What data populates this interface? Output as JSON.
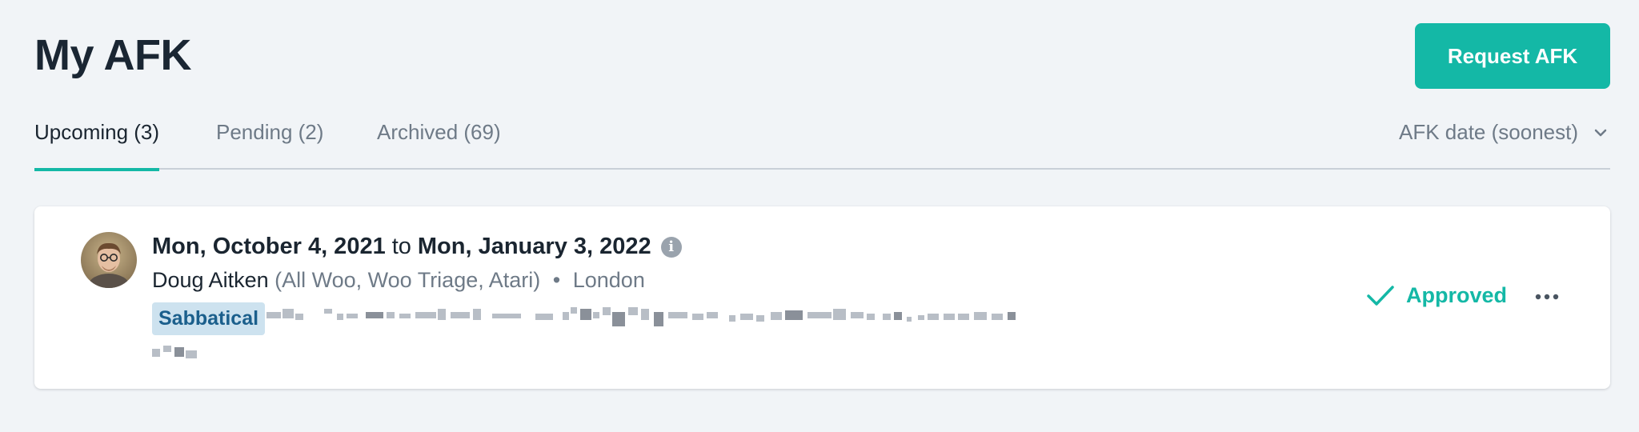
{
  "header": {
    "title": "My AFK",
    "request_button": "Request AFK"
  },
  "tabs": [
    {
      "label": "Upcoming (3)",
      "active": true
    },
    {
      "label": "Pending (2)",
      "active": false
    },
    {
      "label": "Archived (69)",
      "active": false
    }
  ],
  "sort": {
    "selected": "AFK date (soonest)"
  },
  "afk_item": {
    "start_date": "Mon, October 4, 2021",
    "connector": "to",
    "end_date": "Mon, January 3, 2022",
    "person": "Doug Aitken",
    "teams": "(All Woo, Woo Triage, Atari)",
    "separator": "•",
    "location": "London",
    "type": "Sabbatical",
    "status": "Approved"
  },
  "colors": {
    "accent": "#14b8a6",
    "badge_bg": "#cde2ef",
    "badge_text": "#1b5f8c",
    "page_bg": "#f1f4f7"
  },
  "icons": {
    "info": "info-icon",
    "status": "checkmark-icon",
    "more": "more-horizontal-icon",
    "sort": "chevron-down-icon"
  }
}
